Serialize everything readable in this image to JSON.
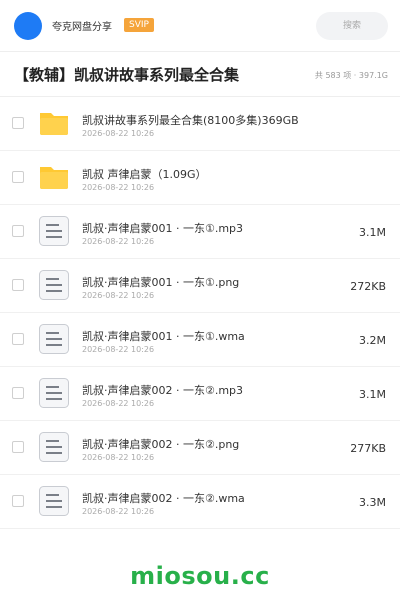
{
  "header": {
    "app_name": "夸克网盘分享",
    "badge": "SVIP",
    "search_placeholder": "搜索"
  },
  "folder": {
    "title": "【教辅】凯叔讲故事系列最全合集",
    "summary": "共 583 项 · 397.1G"
  },
  "files": [
    {
      "name": "凯叔讲故事系列最全合集(8100多集)369GB",
      "date": "2026-08-22 10:26",
      "size": "",
      "kind": "folder"
    },
    {
      "name": "凯叔 声律启蒙（1.09G）",
      "date": "2026-08-22 10:26",
      "size": "",
      "kind": "folder"
    },
    {
      "name": "凯叔·声律启蒙001 · 一东①.mp3",
      "date": "2026-08-22 10:26",
      "size": "3.1M",
      "kind": "file"
    },
    {
      "name": "凯叔·声律启蒙001 · 一东①.png",
      "date": "2026-08-22 10:26",
      "size": "272KB",
      "kind": "file"
    },
    {
      "name": "凯叔·声律启蒙001 · 一东①.wma",
      "date": "2026-08-22 10:26",
      "size": "3.2M",
      "kind": "file"
    },
    {
      "name": "凯叔·声律启蒙002 · 一东②.mp3",
      "date": "2026-08-22 10:26",
      "size": "3.1M",
      "kind": "file"
    },
    {
      "name": "凯叔·声律启蒙002 · 一东②.png",
      "date": "2026-08-22 10:26",
      "size": "277KB",
      "kind": "file"
    },
    {
      "name": "凯叔·声律启蒙002 · 一东②.wma",
      "date": "2026-08-22 10:26",
      "size": "3.3M",
      "kind": "file"
    }
  ],
  "watermark": "miosou.cc",
  "colors": {
    "accent": "#1e7bf5",
    "folder": "#ffc933",
    "badge": "#f5a43a",
    "watermark": "#28b04a"
  }
}
